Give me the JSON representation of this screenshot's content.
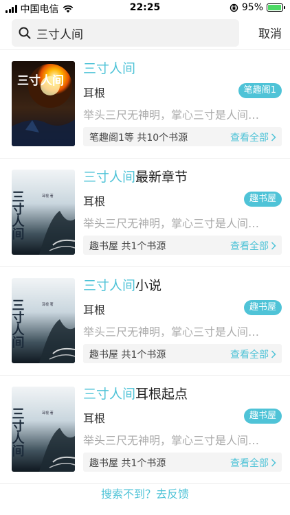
{
  "status_bar": {
    "carrier": "中国电信",
    "time": "22:25",
    "battery_percent": "95%",
    "battery_level": 0.95
  },
  "search": {
    "query": "三寸人间",
    "cancel_label": "取消"
  },
  "results": [
    {
      "title_keyword": "三寸人间",
      "title_rest": "",
      "author": "耳根",
      "badge": "笔趣阁1",
      "description": "举头三尺无神明，掌心三寸是人间…",
      "source_text": "笔趣阁1等 共10个书源",
      "view_all": "查看全部",
      "cover_title": "三寸人间",
      "cover_author": "耳根 著"
    },
    {
      "title_keyword": "三寸人间",
      "title_rest": "最新章节",
      "author": "耳根",
      "badge": "趣书屋",
      "description": "举头三尺无神明，掌心三寸是人间…",
      "source_text": "趣书屋 共1个书源",
      "view_all": "查看全部",
      "cover_title": "三寸人间",
      "cover_author": "耳根 著"
    },
    {
      "title_keyword": "三寸人间",
      "title_rest": "小说",
      "author": "耳根",
      "badge": "趣书屋",
      "description": "举头三尺无神明，掌心三寸是人间…",
      "source_text": "趣书屋 共1个书源",
      "view_all": "查看全部",
      "cover_title": "三寸人间",
      "cover_author": "耳根 著"
    },
    {
      "title_keyword": "三寸人间",
      "title_rest": "耳根起点",
      "author": "耳根",
      "badge": "趣书屋",
      "description": "举头三尺无神明，掌心三寸是人间…",
      "source_text": "趣书屋 共1个书源",
      "view_all": "查看全部",
      "cover_title": "三寸人间",
      "cover_author": "耳根 著"
    }
  ],
  "feedback_label": "搜索不到？去反馈",
  "colors": {
    "accent": "#4fc3d7",
    "battery": "#4cd964"
  }
}
